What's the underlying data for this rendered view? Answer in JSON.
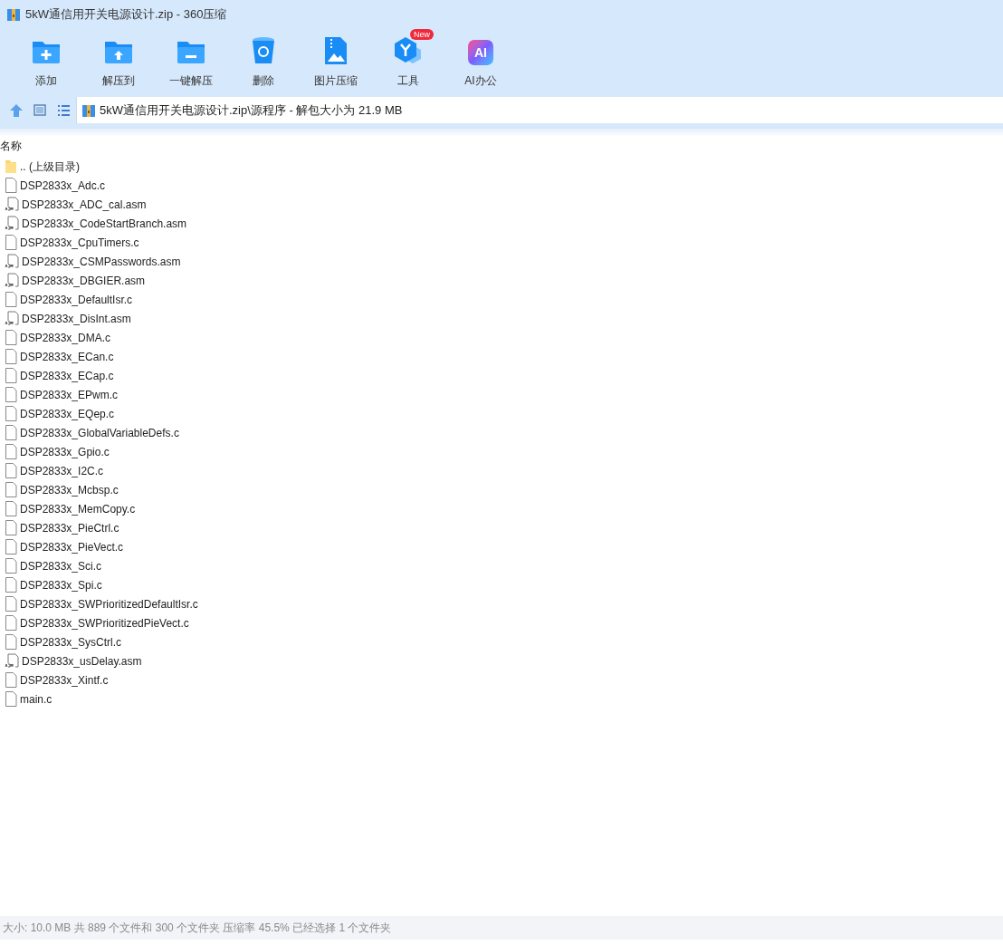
{
  "window": {
    "title": "5kW通信用开关电源设计.zip - 360压缩"
  },
  "toolbar": [
    {
      "label": "添加",
      "kind": "add"
    },
    {
      "label": "解压到",
      "kind": "extract"
    },
    {
      "label": "一键解压",
      "kind": "quick"
    },
    {
      "label": "删除",
      "kind": "delete"
    },
    {
      "label": "图片压缩",
      "kind": "image"
    },
    {
      "label": "工具",
      "kind": "tools",
      "badge": "New"
    },
    {
      "label": "AI办公",
      "kind": "ai",
      "glyph": "AI"
    }
  ],
  "address_bar": {
    "path": "5kW通信用开关电源设计.zip\\源程序 - 解包大小为 21.9 MB"
  },
  "file_list": {
    "column": "名称",
    "rows": [
      {
        "name": ".. (上级目录)",
        "kind": "folder"
      },
      {
        "name": "DSP2833x_Adc.c",
        "kind": "file"
      },
      {
        "name": "DSP2833x_ADC_cal.asm",
        "kind": "asm"
      },
      {
        "name": "DSP2833x_CodeStartBranch.asm",
        "kind": "asm"
      },
      {
        "name": "DSP2833x_CpuTimers.c",
        "kind": "file"
      },
      {
        "name": "DSP2833x_CSMPasswords.asm",
        "kind": "asm"
      },
      {
        "name": "DSP2833x_DBGIER.asm",
        "kind": "asm"
      },
      {
        "name": "DSP2833x_DefaultIsr.c",
        "kind": "file"
      },
      {
        "name": "DSP2833x_DisInt.asm",
        "kind": "asm"
      },
      {
        "name": "DSP2833x_DMA.c",
        "kind": "file"
      },
      {
        "name": "DSP2833x_ECan.c",
        "kind": "file"
      },
      {
        "name": "DSP2833x_ECap.c",
        "kind": "file"
      },
      {
        "name": "DSP2833x_EPwm.c",
        "kind": "file"
      },
      {
        "name": "DSP2833x_EQep.c",
        "kind": "file"
      },
      {
        "name": "DSP2833x_GlobalVariableDefs.c",
        "kind": "file"
      },
      {
        "name": "DSP2833x_Gpio.c",
        "kind": "file"
      },
      {
        "name": "DSP2833x_I2C.c",
        "kind": "file"
      },
      {
        "name": "DSP2833x_Mcbsp.c",
        "kind": "file"
      },
      {
        "name": "DSP2833x_MemCopy.c",
        "kind": "file"
      },
      {
        "name": "DSP2833x_PieCtrl.c",
        "kind": "file"
      },
      {
        "name": "DSP2833x_PieVect.c",
        "kind": "file"
      },
      {
        "name": "DSP2833x_Sci.c",
        "kind": "file"
      },
      {
        "name": "DSP2833x_Spi.c",
        "kind": "file"
      },
      {
        "name": "DSP2833x_SWPrioritizedDefaultIsr.c",
        "kind": "file"
      },
      {
        "name": "DSP2833x_SWPrioritizedPieVect.c",
        "kind": "file"
      },
      {
        "name": "DSP2833x_SysCtrl.c",
        "kind": "file"
      },
      {
        "name": "DSP2833x_usDelay.asm",
        "kind": "asm"
      },
      {
        "name": "DSP2833x_Xintf.c",
        "kind": "file"
      },
      {
        "name": "main.c",
        "kind": "file"
      }
    ]
  },
  "status_bar": "大小: 10.0 MB 共 889 个文件和 300 个文件夹 压缩率 45.5% 已经选择 1 个文件夹"
}
